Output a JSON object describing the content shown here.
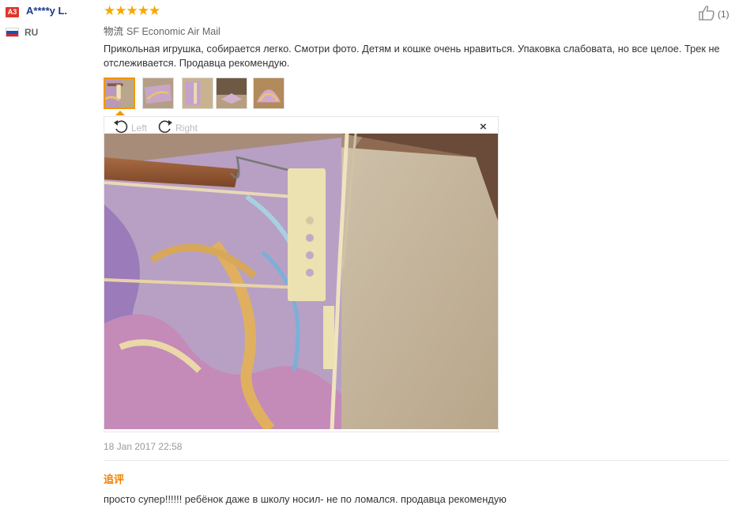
{
  "reviewer": {
    "badge": "A3",
    "name": "A****y L.",
    "country": "RU",
    "flag_colors": [
      "#ffffff",
      "#1c4fb3",
      "#d7272a"
    ]
  },
  "rating": {
    "stars": "★★★★★",
    "value": 5,
    "max": 5
  },
  "helpful": {
    "icon": "thumbs-up-icon",
    "count": "(1)"
  },
  "shipping": {
    "label": "物流",
    "method": "SF Economic Air Mail"
  },
  "review": {
    "text": "Прикольная игрушка, собирается легко. Смотри фото. Детям и кошке очень нравиться. Упаковка слабовата, но все целое. Трек не отслеживается. Продавца рекомендую."
  },
  "photos": {
    "thumbnails": [
      "photo-1",
      "photo-2",
      "photo-3",
      "photo-4",
      "photo-5"
    ],
    "selected_index": 0
  },
  "viewer": {
    "rotate_left": "Left",
    "rotate_right": "Right",
    "close": "×"
  },
  "date": "18 Jan 2017 22:58",
  "followup": {
    "label": "追评",
    "text": "просто супер!!!!!! ребёнок даже в школу носил- не по ломался. продавца рекомендую"
  },
  "colors": {
    "accent": "#f39700",
    "star": "#f6a800",
    "name": "#1b3a8c",
    "badge": "#e0352b"
  }
}
